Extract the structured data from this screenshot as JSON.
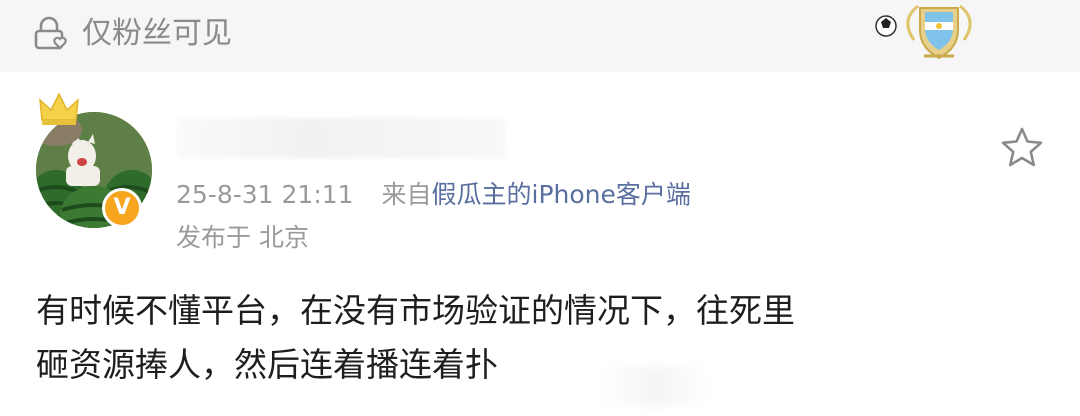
{
  "visibility": {
    "label": "仅粉丝可见",
    "icon": "lock-heart-icon"
  },
  "badge": {
    "icon": "argentina-football-badge-icon"
  },
  "user": {
    "avatar_icon": "watermelon-cat-avatar",
    "crown_icon": "crown-icon",
    "verified_icon": "verified-v-icon",
    "verified_text": "V"
  },
  "meta": {
    "datetime": "25-8-31 21:11",
    "source_prefix": "来自",
    "source_name": "假瓜主的iPhone客户端",
    "location": "发布于 北京"
  },
  "actions": {
    "favorite_icon": "star-icon"
  },
  "post": {
    "lines": [
      "有时候不懂平台，在没有市场验证的情况下，往死里",
      "砸资源捧人，然后连着播连着扑"
    ]
  },
  "colors": {
    "bar_bg": "#f6f6f6",
    "meta_gray": "#9a9a9a",
    "source_blue": "#5a6fa0",
    "badge_orange": "#f7a51e"
  }
}
